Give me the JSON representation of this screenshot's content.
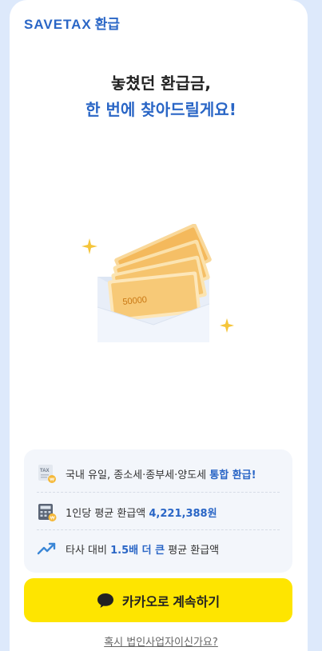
{
  "brand": {
    "logo_en": "SAVETAX",
    "logo_ko": "환급",
    "accent": "#2a66c6"
  },
  "hero": {
    "line1": "놓쳤던 환급금,",
    "line2": "한 번에 찾아드릴게요!"
  },
  "illustration": {
    "bill_text": "50000"
  },
  "features": {
    "item1": {
      "text": "국내 유일, 종소세·종부세·양도세 ",
      "highlight": "통합 환급!",
      "badge": "TAX",
      "icon": "tax-doc-icon"
    },
    "item2": {
      "text": "1인당 평균 환급액 ",
      "highlight": "4,221,388원",
      "icon": "calculator-icon"
    },
    "item3": {
      "pre": "타사 대비 ",
      "highlight": "1.5배 더 큰",
      "post": " 평균 환급액",
      "icon": "trend-up-icon"
    }
  },
  "cta": {
    "label": "카카오로 계속하기",
    "color": "#fee500",
    "icon": "speech-bubble-icon"
  },
  "corporate_link": "혹시 법인사업자이신가요?"
}
